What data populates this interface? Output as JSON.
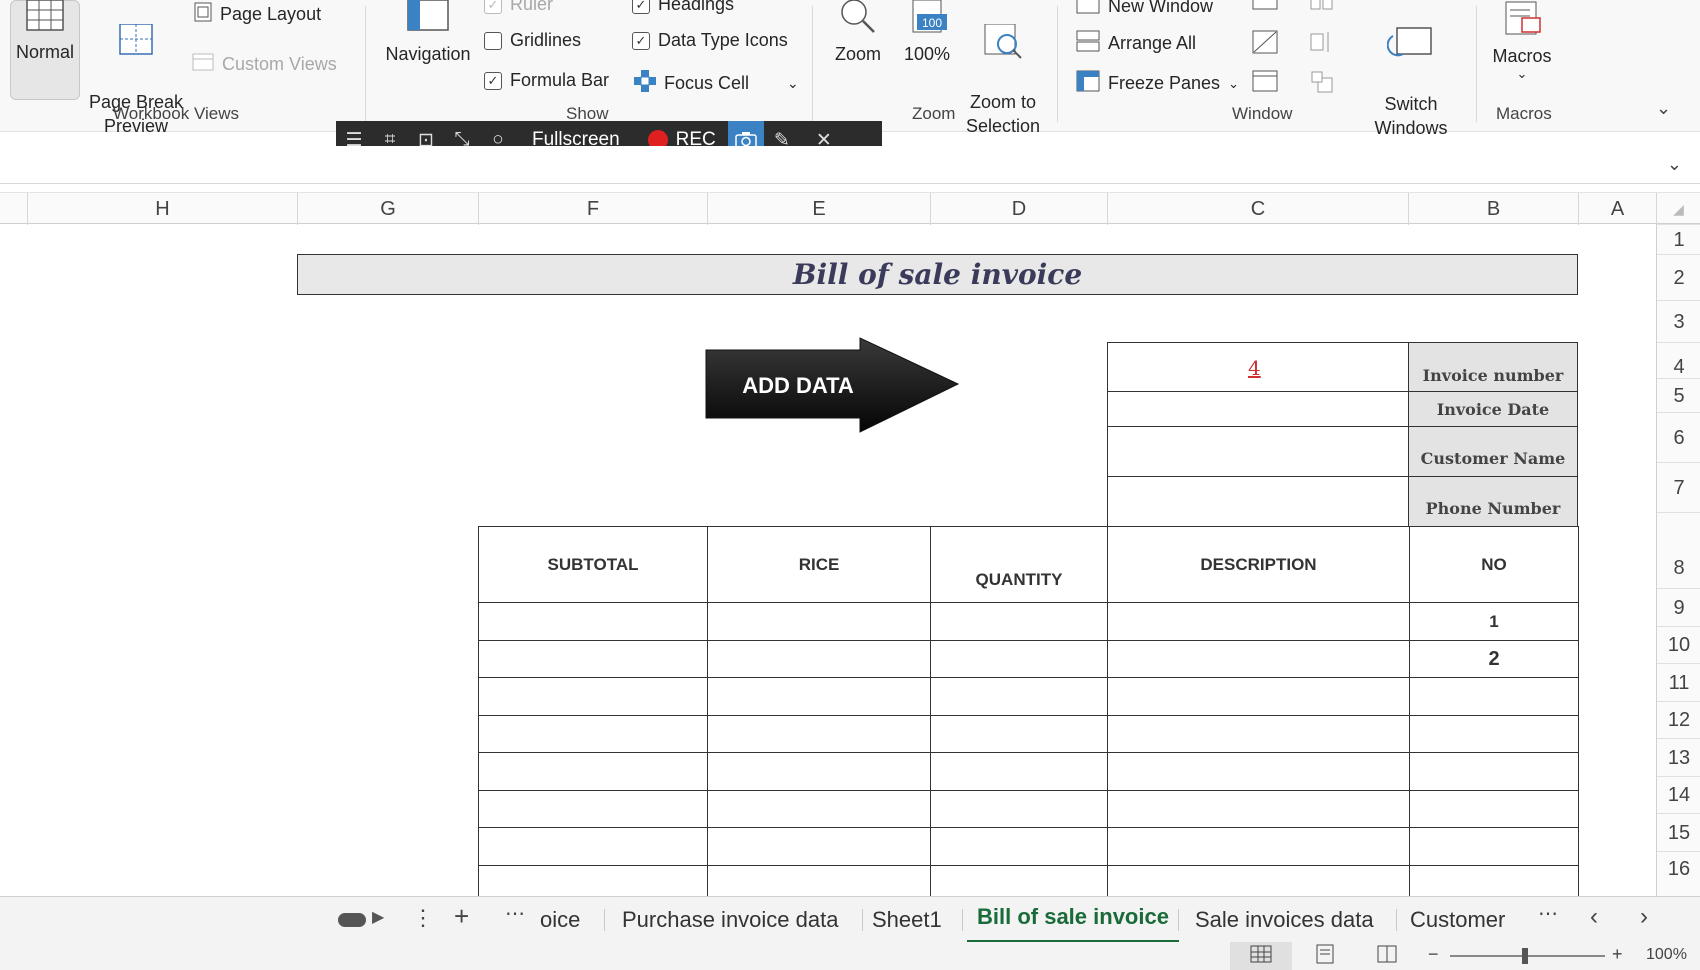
{
  "ribbon": {
    "normal_label": "Normal",
    "page_break_label": "Page Break\nPreview",
    "page_layout_label": "Page Layout",
    "custom_views_label": "Custom Views",
    "workbook_views_group": "Workbook Views",
    "navigation_label": "Navigation",
    "ruler_label": "Ruler",
    "headings_label": "Headings",
    "gridlines_label": "Gridlines",
    "data_type_icons_label": "Data Type Icons",
    "formula_bar_label": "Formula Bar",
    "focus_cell_label": "Focus Cell",
    "show_group": "Show",
    "zoom_label": "Zoom",
    "zoom100_label": "100%",
    "zoom_to_sel_label": "Zoom to\nSelection",
    "zoom_group": "Zoom",
    "new_window_label": "New Window",
    "arrange_all_label": "Arrange All",
    "freeze_panes_label": "Freeze Panes",
    "window_group": "Window",
    "switch_windows_label": "Switch\nWindows",
    "macros_label": "Macros",
    "macros_group": "Macros"
  },
  "floatbar": {
    "fullscreen_label": "Fullscreen",
    "rec_label": "REC"
  },
  "columns": [
    "H",
    "G",
    "F",
    "E",
    "D",
    "C",
    "B",
    "A"
  ],
  "rows": [
    "1",
    "2",
    "3",
    "4",
    "5",
    "6",
    "7",
    "8",
    "9",
    "10",
    "11",
    "12",
    "13",
    "14",
    "15",
    "16"
  ],
  "sheet": {
    "title": "Bill of sale invoice",
    "add_data_label": "ADD DATA",
    "invoice_number_value": "4",
    "labels": {
      "invoice_number": "Invoice number",
      "invoice_date": "Invoice Date",
      "customer_name": "Customer Name",
      "phone_number": "Phone Number"
    },
    "table_headers": {
      "subtotal": "SUBTOTAL",
      "rice": "RICE",
      "quantity": "QUANTITY",
      "description": "DESCRIPTION",
      "no": "NO"
    },
    "row_numbers": [
      "1",
      "2"
    ]
  },
  "tabs": {
    "partial": "oice",
    "purchase_invoice_data": "Purchase invoice data",
    "sheet1": "Sheet1",
    "bill_of_sale_invoice": "Bill of sale invoice",
    "sale_invoices_data": "Sale invoices data",
    "customer": "Customer"
  },
  "status": {
    "zoom_value": "100%"
  },
  "colors": {
    "accent_green": "#1a6b3a",
    "invoice_number_red": "#d03030",
    "rec_red": "#e02020",
    "camera_blue": "#3b82c4"
  }
}
